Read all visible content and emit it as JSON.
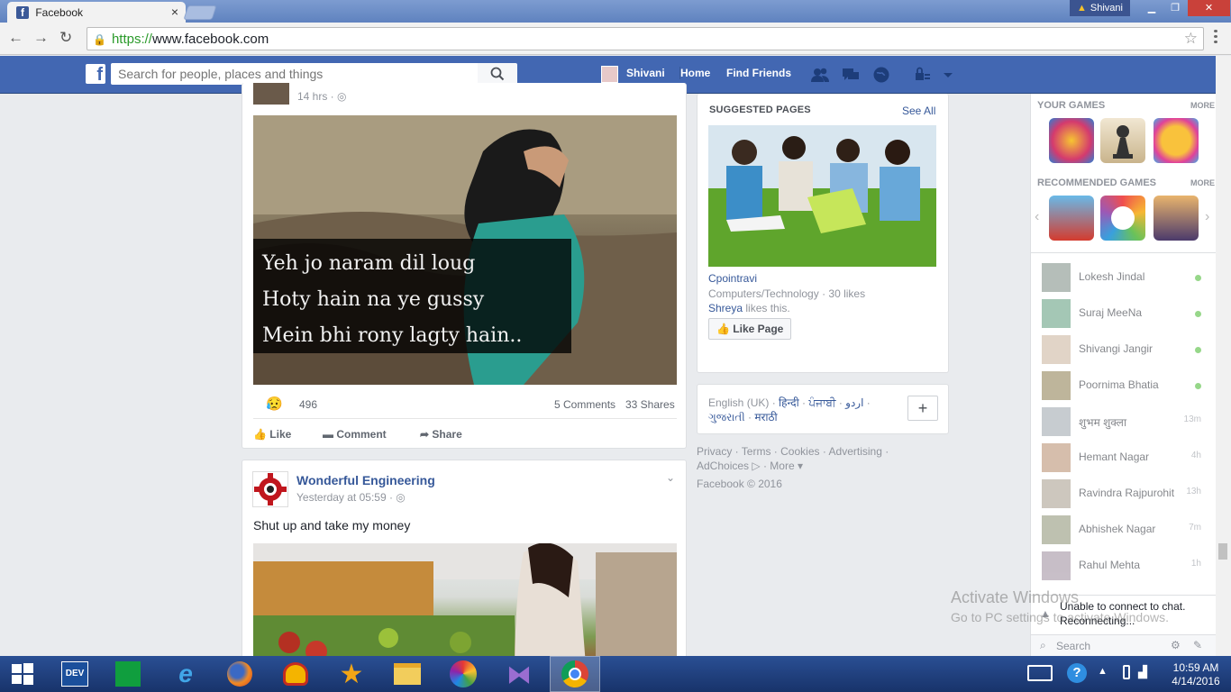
{
  "browser": {
    "tab_title": "Facebook",
    "tab_close": "×",
    "profile_name": "Shivani",
    "url_scheme": "https://",
    "url_rest": "www.facebook.com"
  },
  "fb_header": {
    "search_placeholder": "Search for people, places and things",
    "user_name": "Shivani",
    "home": "Home",
    "find_friends": "Find Friends"
  },
  "post1": {
    "time": "14 hrs · ",
    "caption_lines": [
      "Yeh jo naram dil loug",
      "Hoty hain na ye gussy",
      "Mein bhi rony lagty hain.."
    ],
    "reactions": "496",
    "comments": "5 Comments",
    "shares": "33 Shares",
    "like": "Like",
    "comment": "Comment",
    "share": "Share"
  },
  "post2": {
    "page_name": "Wonderful Engineering",
    "time": "Yesterday at 05:59 · ",
    "text": "Shut up and take my money"
  },
  "suggested": {
    "title": "SUGGESTED PAGES",
    "see_all": "See All",
    "page_name": "Cpointravi",
    "category": "Computers/Technology · 30 likes",
    "liker": "Shreya",
    "likes_this": " likes this.",
    "like_button": "Like Page"
  },
  "languages": {
    "current": "English (UK) · ",
    "others": [
      "हिन्दी",
      "ਪੰਜਾਬੀ",
      "اردو",
      "ગુજરાતી",
      "मराठी"
    ],
    "plus": "+"
  },
  "footer": {
    "links": [
      "Privacy",
      "Terms",
      "Cookies",
      "Advertising",
      "AdChoices",
      "More"
    ],
    "copyright": "Facebook © 2016"
  },
  "sidebar": {
    "your_games": "YOUR GAMES",
    "recommended_games": "RECOMMENDED GAMES",
    "more": "MORE",
    "contacts": [
      {
        "name": "Lokesh Jindal",
        "status": "online"
      },
      {
        "name": "Suraj MeeNa",
        "status": "online"
      },
      {
        "name": "Shivangi Jangir",
        "status": "online"
      },
      {
        "name": "Poornima Bhatia",
        "status": "online"
      },
      {
        "name": "शुभम शुक्ला",
        "status": "13m"
      },
      {
        "name": "Hemant Nagar",
        "status": "4h"
      },
      {
        "name": "Ravindra Rajpurohit",
        "status": "13h"
      },
      {
        "name": "Abhishek Nagar",
        "status": "7m"
      },
      {
        "name": "Rahul Mehta",
        "status": "1h"
      }
    ],
    "chat_warning_1": "Unable to connect to chat.",
    "chat_warning_2": "Reconnecting...",
    "search": "Search"
  },
  "watermark": {
    "line1": "Activate Windows",
    "line2": "Go to PC settings to activate Windows."
  },
  "taskbar": {
    "time": "10:59 AM",
    "date": "4/14/2016",
    "dev_label": "DEV"
  },
  "colors": {
    "fb_blue": "#4267b2",
    "link_blue": "#365899",
    "online_green": "#42b72a",
    "taskbar": "#1f3e7c"
  }
}
